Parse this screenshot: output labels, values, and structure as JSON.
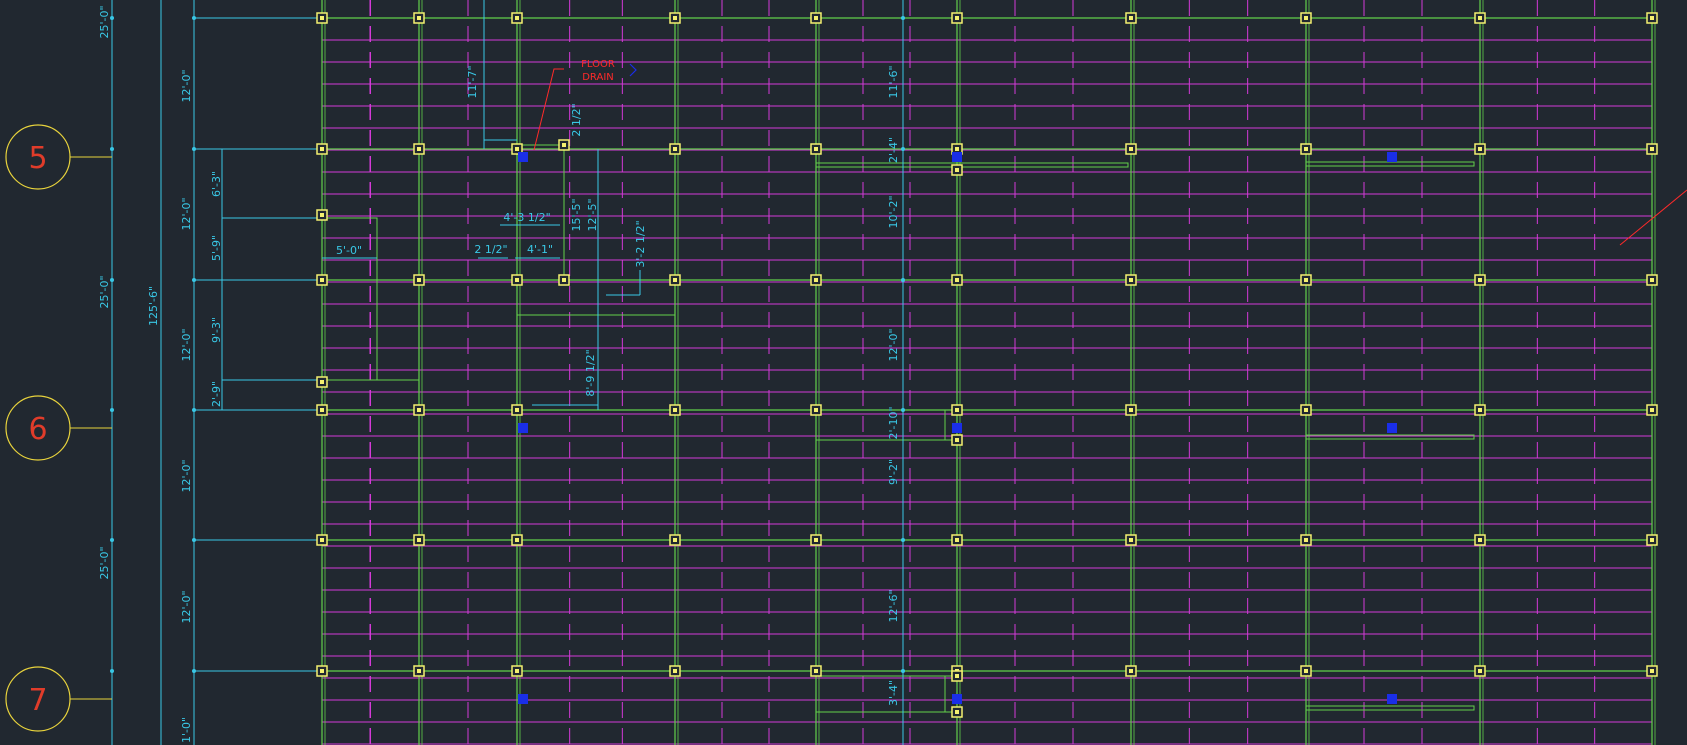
{
  "drawing": {
    "colors": {
      "background": "#212830",
      "framing": "#62d04a",
      "joists": "#d43ad8",
      "dimension": "#39c8e6",
      "node": "#f4f070",
      "drain": "#1a2ee8",
      "bubble": "#e8d33c",
      "bubble_text": "#e03c2a",
      "note": "#ff2a2a"
    },
    "grid_bubbles": [
      "5",
      "6",
      "7"
    ],
    "left_dims_bay": [
      "25'-0\"",
      "25'-0\"",
      "25'-0\"",
      "125'-6\""
    ],
    "left_dims_12": [
      "12'-0\"",
      "12'-0\"",
      "12'-0\"",
      "12'-0\"",
      "12'-0\"",
      "1'-0\""
    ],
    "left_dims_small": [
      "6'-3\"",
      "5'-9\"",
      "9'-3\"",
      "2'-9\"",
      "5'-0\""
    ],
    "center_dims": [
      "11'-7\"",
      "4'-3 1/2\"",
      "2 1/2\"",
      "4'-1\"",
      "15'-5\"",
      "12'-5\"",
      "2 1/2\"",
      "3'-2 1/2\"",
      "8'-9 1/2\""
    ],
    "right_dims": [
      "11'-6\"",
      "2'-4\"",
      "10'-2\"",
      "12'-0\"",
      "2'-10\"",
      "9'-2\"",
      "12'-6\"",
      "3'-4\""
    ],
    "note": {
      "line1": "FLOOR",
      "line2": "DRAIN"
    }
  }
}
